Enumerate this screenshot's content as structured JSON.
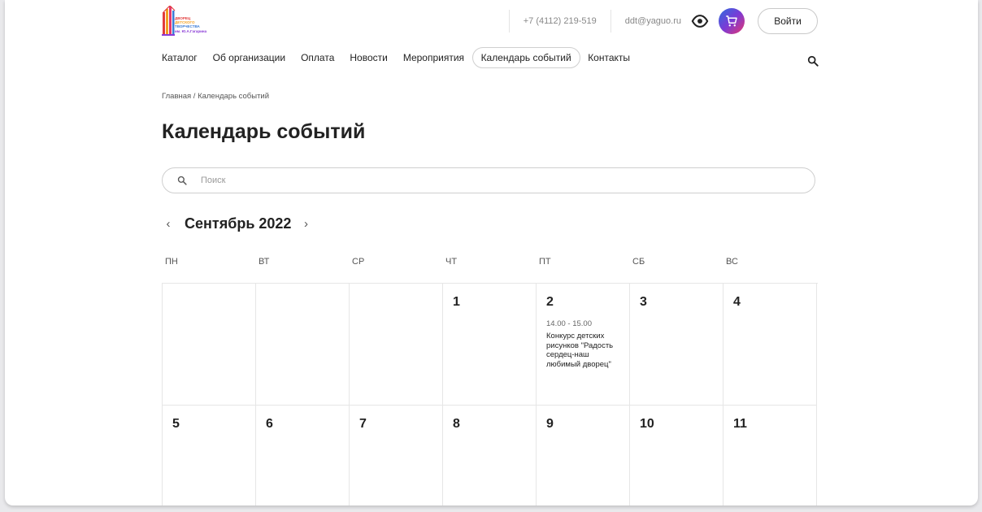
{
  "header": {
    "logo_text": [
      "ДВОРЕЦ",
      "ДЕТСКОГО",
      "ТВОРЧЕСТВА",
      "им. Ю.А.Гагарина"
    ],
    "phone": "+7 (4112) 219-519",
    "email": "ddt@yaguo.ru",
    "accessibility_icon": "eye-icon",
    "cart_icon": "cart-icon",
    "login_label": "Войти",
    "accent_gradient": [
      "#2e6dde",
      "#7a3bd6",
      "#e8366e"
    ]
  },
  "nav": {
    "items": [
      {
        "label": "Каталог"
      },
      {
        "label": "Об организации"
      },
      {
        "label": "Оплата"
      },
      {
        "label": "Новости"
      },
      {
        "label": "Мероприятия"
      },
      {
        "label": "Календарь событий",
        "active": true
      },
      {
        "label": "Контакты"
      }
    ],
    "search_icon": "search-icon"
  },
  "breadcrumb": "Главная / Календарь событий",
  "page_title": "Календарь событий",
  "search": {
    "placeholder": "Поиск",
    "value": ""
  },
  "calendar": {
    "month_label": "Сентябрь 2022",
    "weekdays": [
      "ПН",
      "ВТ",
      "СР",
      "ЧТ",
      "ПТ",
      "СБ",
      "ВС"
    ],
    "weeks": [
      [
        {
          "day": ""
        },
        {
          "day": ""
        },
        {
          "day": ""
        },
        {
          "day": "1"
        },
        {
          "day": "2",
          "events": [
            {
              "time": "14.00 - 15.00",
              "title": "Конкурс детских рисунков \"Радость сердец-наш любимый дворец\""
            }
          ]
        },
        {
          "day": "3"
        },
        {
          "day": "4"
        }
      ],
      [
        {
          "day": "5"
        },
        {
          "day": "6"
        },
        {
          "day": "7"
        },
        {
          "day": "8"
        },
        {
          "day": "9"
        },
        {
          "day": "10"
        },
        {
          "day": "11"
        }
      ]
    ]
  }
}
